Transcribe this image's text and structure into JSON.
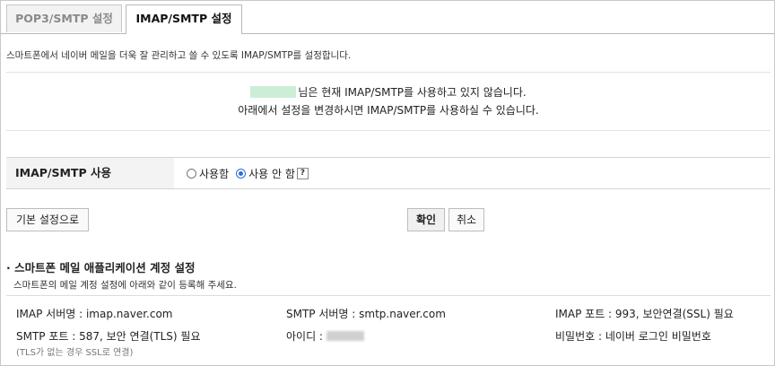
{
  "tabs": [
    {
      "label": "POP3/SMTP 설정",
      "active": false
    },
    {
      "label": "IMAP/SMTP 설정",
      "active": true
    }
  ],
  "description": "스마트폰에서 네이버 메일을 더욱 잘 관리하고 쓸 수 있도록 IMAP/SMTP를 설정합니다.",
  "notice": {
    "line1_suffix": "님은 현재 IMAP/SMTP를 사용하고 있지 않습니다.",
    "line2": "아래에서 설정을 변경하시면 IMAP/SMTP를 사용하실 수 있습니다."
  },
  "setting": {
    "label": "IMAP/SMTP 사용",
    "options": [
      {
        "label": "사용함",
        "checked": false
      },
      {
        "label": "사용 안 함",
        "checked": true
      }
    ],
    "help_label": "?"
  },
  "buttons": {
    "default_label": "기본 설정으로",
    "confirm_label": "확인",
    "cancel_label": "취소"
  },
  "section": {
    "title": "· 스마트폰 메일 애플리케이션 계정 설정",
    "subtitle": "스마트폰의 메일 계정 설정에 아래와 같이 등록해 주세요."
  },
  "info": {
    "imap_server": "IMAP 서버명 : imap.naver.com",
    "smtp_server": "SMTP 서버명 : smtp.naver.com",
    "imap_port": "IMAP 포트 : 993, 보안연결(SSL) 필요",
    "smtp_port": "SMTP 포트 : 587, 보안 연결(TLS) 필요",
    "smtp_port_note": "(TLS가 없는 경우 SSL로 연결)",
    "id_label": "아이디 :",
    "password": "비밀번호 : 네이버 로그인 비밀번호"
  },
  "colors": {
    "accent": "#2a6fd6",
    "masked_name": "#cdeed6"
  }
}
